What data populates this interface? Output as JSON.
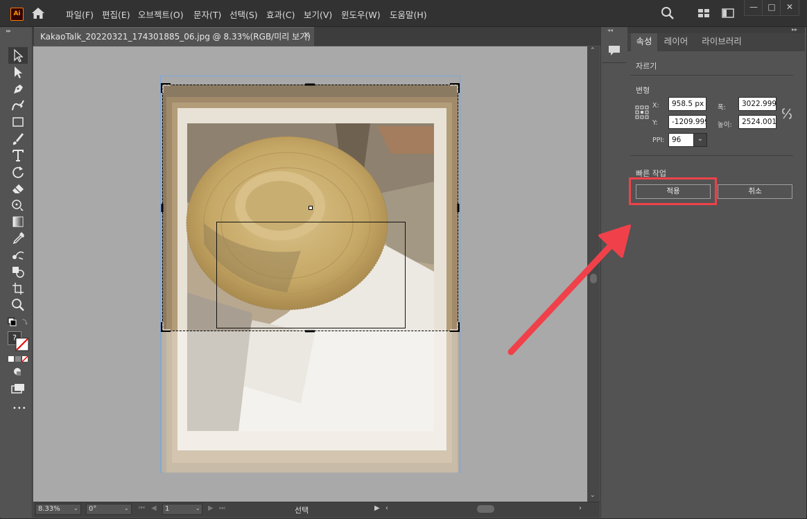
{
  "app": {
    "logo_text": "Ai",
    "accent_color": "#ff9a00"
  },
  "menu": {
    "items": [
      "파일(F)",
      "편집(E)",
      "오브젝트(O)",
      "문자(T)",
      "선택(S)",
      "효과(C)",
      "보기(V)",
      "윈도우(W)",
      "도움말(H)"
    ]
  },
  "window_controls": {
    "minimize": "—",
    "maximize": "□",
    "close": "✕"
  },
  "document": {
    "tab_title": "KakaoTalk_20220321_174301885_06.jpg @ 8.33%(RGB/미리 보기)",
    "close_glyph": "×"
  },
  "tools": [
    "selection-tool",
    "direct-selection-tool",
    "pen-tool",
    "curvature-tool",
    "rectangle-tool",
    "paintbrush-tool",
    "type-tool",
    "rotate-tool",
    "eraser-tool",
    "puppet-warp-tool",
    "gradient-tool",
    "eyedropper-tool",
    "blend-tool",
    "shape-builder-tool",
    "artboard-tool",
    "zoom-tool"
  ],
  "toolbar_extra": {
    "more_label": "•••",
    "question": "?"
  },
  "right_panel": {
    "tabs": [
      "속성",
      "레이어",
      "라이브러리"
    ],
    "section_title": "자르기",
    "transform_title": "변형",
    "x_label": "X:",
    "x_value": "958.5 px",
    "y_label": "Y:",
    "y_value": "-1209.999",
    "width_label": "폭:",
    "width_value": "3022.9999",
    "height_label": "높이:",
    "height_value": "2524.0014",
    "ppi_label": "PPI:",
    "ppi_value": "96",
    "quick_actions_title": "빠른 작업",
    "apply_label": "적용",
    "cancel_label": "취소",
    "highlight_color": "#f0414a"
  },
  "status_bar": {
    "zoom": "8.33%",
    "rotation": "0°",
    "page": "1",
    "mode": "선택"
  }
}
